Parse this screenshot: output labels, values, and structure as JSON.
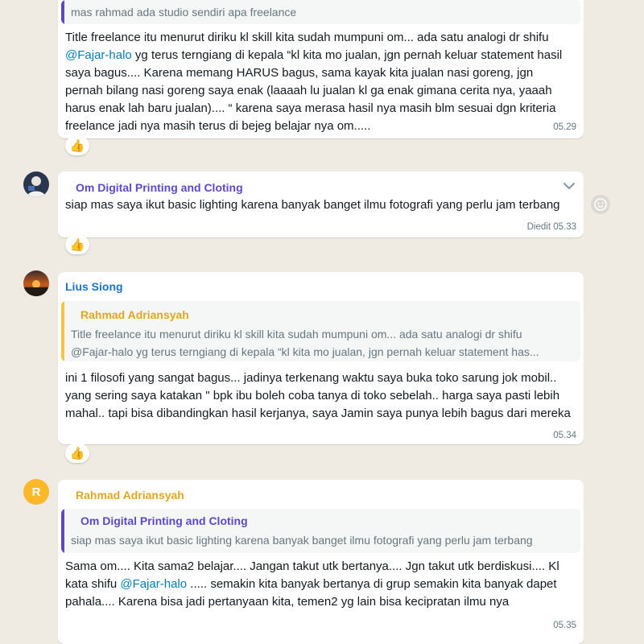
{
  "colors": {
    "background": "#efeae2",
    "bubble": "#ffffff",
    "sender_purple": "#5e48c7",
    "sender_blue": "#1a73c8",
    "sender_yellow": "#e0a820",
    "mention": "#027eb5"
  },
  "messages": [
    {
      "quote_text": "mas rahmad ada studio sendiri apa freelance",
      "body_before_mention": "Title freelance itu menurut diriku kl skill kita sudah mumpuni om... ada satu analogi dr shifu ",
      "mention": "@Fajar-halo",
      "body_after_mention": " yg terus terngiang di kepala “kl kita mo jualan, jgn pernah keluar statement hasil saya bagus.... Karena memang HARUS bagus, sama kayak kita jualan nasi goreng, jgn pernah bilang nasi goreng saya enak (laaaah lu jualan kl ga enak gimana cerita nya, yaaah harus enak lah baru jualan).... “ karena saya merasa hasil nya masih blm sesuai dgn kriteria freelance jadi nya masih terus di bejeg belajar nya om.....",
      "time": "05.29",
      "reaction": "👍"
    },
    {
      "sender": "Om Digital Printing and Cloting",
      "body": "siap mas saya ikut  basic lighting karena banyak banget ilmu fotografi yang perlu jam terbang",
      "edited": "Diedit",
      "time": "05.33",
      "reaction": "👍",
      "menu_icon": "chevron-down-icon",
      "emoji_button_icon": "smiley-icon"
    },
    {
      "sender": "Lius Siong",
      "quote_sender": "Rahmad Adriansyah",
      "quote_line1": "Title freelance itu menurut diriku kl skill kita sudah mumpuni om... ada satu analogi dr shifu",
      "quote_line2": "@Fajar-halo yg terus terngiang di kepala “kl kita mo jualan, jgn pernah keluar statement has...",
      "body": "ini 1 filosofi yang sangat bagus... jadinya terkenang waktu saya buka toko sarung jok mobil.. yang sering saya katakan \" bpk ibu boleh coba tanya di toko sebelah.. harga saya pasti  lebih mahal.. tapi bisa dibandingkan hasil kerjanya, saya Jamin saya punya lebih bagus dari mereka",
      "time": "05.34",
      "reaction": "👍"
    },
    {
      "sender": "Rahmad Adriansyah",
      "avatar_letter": "R",
      "quote_sender": "Om Digital Printing and Cloting",
      "quote_text": "siap mas saya ikut  basic lighting karena banyak banget ilmu fotografi yang perlu jam terbang",
      "body_before_mention": "Sama om.... Kita sama2 belajar.... Jangan takut utk bertanya.... Jgn takut utk berdiskusi.... Kl kata shifu ",
      "mention": "@Fajar-halo",
      "body_after_mention": " ..... semakin kita banyak bertanya di grup semakin kita banyak dapet pahala.... Karena bisa jadi pertanyaan kita, temen2 yg lain bisa kecipratan ilmu nya",
      "time": "05.35"
    }
  ]
}
